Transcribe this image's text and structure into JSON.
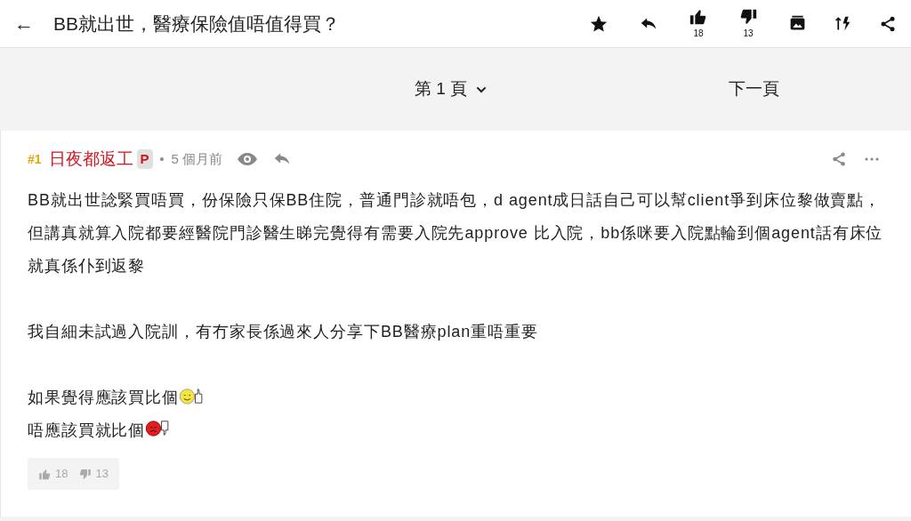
{
  "header": {
    "back": "←",
    "title": "BB就出世，醫療保險值唔值得買？",
    "like_count": "18",
    "dislike_count": "13"
  },
  "pager": {
    "page_label": "第 1 頁",
    "next": "下一頁"
  },
  "post": {
    "number": "#1",
    "author": "日夜都返工",
    "badge": "P",
    "dot": "•",
    "time": "5 個月前",
    "paragraphs": [
      {
        "text": "BB就出世諗緊買唔買，份保險只保BB住院，普通門診就唔包，d agent成日話自己可以幫client爭到床位黎做賣點，但講真就算入院都要經醫院門診醫生睇完覺得有需要入院先approve 比入院，bb係咪要入院點輪到個agent話有床位就真係仆到返黎"
      },
      {
        "text": "我自細未試過入院訓，有冇家長係過來人分享下BB醫療plan重唔重要"
      },
      {
        "lines": [
          {
            "text": "如果覺得應該買比個",
            "kind": "up"
          },
          {
            "text": "唔應該買就比個",
            "kind": "down"
          }
        ]
      }
    ],
    "likes": "18",
    "dislikes": "13"
  }
}
